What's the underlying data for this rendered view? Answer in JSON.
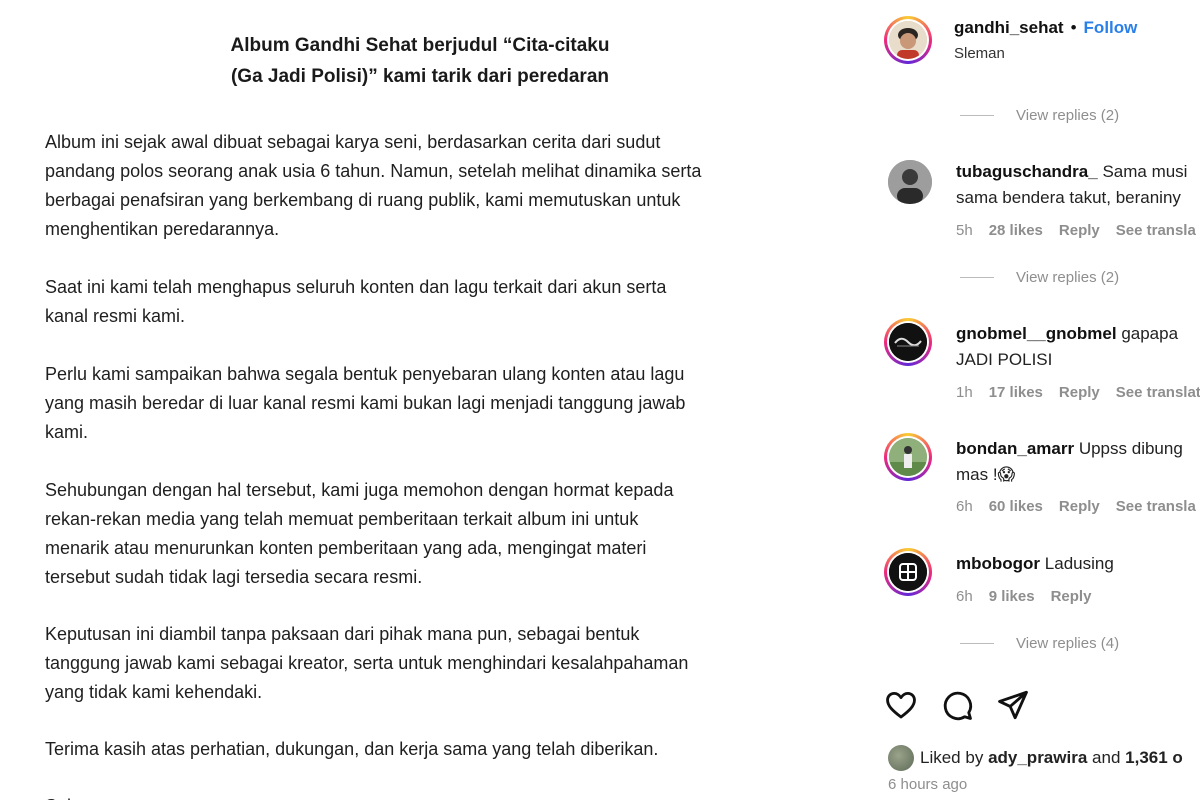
{
  "post": {
    "title_lines": [
      "Album Gandhi Sehat berjudul “Cita-citaku",
      "(Ga Jadi Polisi)” kami tarik dari peredaran"
    ],
    "paragraphs": [
      [
        "Album ini sejak awal dibuat sebagai karya seni, berdasarkan cerita dari sudut",
        "pandang polos seorang anak usia 6 tahun. Namun, setelah melihat dinamika serta",
        "berbagai penafsiran yang berkembang di ruang publik, kami memutuskan untuk",
        "menghentikan peredarannya."
      ],
      [
        "Saat ini kami telah menghapus seluruh konten dan lagu terkait dari akun serta",
        "kanal resmi kami."
      ],
      [
        "Perlu kami sampaikan bahwa segala bentuk penyebaran ulang konten atau lagu",
        "yang masih beredar di luar kanal resmi kami bukan lagi menjadi tanggung jawab",
        "kami."
      ],
      [
        "Sehubungan dengan hal tersebut, kami juga memohon dengan hormat kepada",
        "rekan-rekan media yang telah memuat pemberitaan terkait album ini untuk",
        "menarik atau menurunkan konten pemberitaan yang ada, mengingat materi",
        "tersebut sudah tidak lagi tersedia secara resmi."
      ],
      [
        "Keputusan ini diambil tanpa paksaan dari pihak mana pun, sebagai bentuk",
        "tanggung jawab kami sebagai kreator, serta untuk menghindari kesalahpahaman",
        "yang tidak kami kehendaki."
      ],
      [
        "Terima kasih atas perhatian, dukungan, dan kerja sama yang telah diberikan."
      ]
    ],
    "trailing_stub": "Sal"
  },
  "header": {
    "username": "gandhi_sehat",
    "separator": "•",
    "follow": "Follow",
    "location": "Sleman"
  },
  "comments": [
    {
      "username": "tubaguschandra_",
      "text_line1": "Sama musi",
      "text_line2": "sama bendera takut, beraniny",
      "time": "5h",
      "likes": "28 likes",
      "reply": "Reply",
      "translate": "See transla"
    },
    {
      "username": "gnobmel__gnobmel",
      "text_line1": "gapapa",
      "text_line2": "JADI POLISI",
      "time": "1h",
      "likes": "17 likes",
      "reply": "Reply",
      "translate": "See translat"
    },
    {
      "username": "bondan_amarr",
      "text_line1": "Uppss dibung",
      "text_line2": "mas !😱",
      "time": "6h",
      "likes": "60 likes",
      "reply": "Reply",
      "translate": "See transla"
    },
    {
      "username": "mbobogor",
      "text_line1": "Ladusing",
      "text_line2": "",
      "time": "6h",
      "likes": "9 likes",
      "reply": "Reply",
      "translate": ""
    }
  ],
  "view_replies": [
    "View replies (2)",
    "View replies (2)",
    "View replies (4)"
  ],
  "actions": {
    "like_icon": "heart-icon",
    "comment_icon": "comment-icon",
    "share_icon": "send-icon"
  },
  "likes_summary": {
    "prefix": "Liked by",
    "user": "ady_prawira",
    "middle": "and",
    "count": "1,361 o"
  },
  "timestamp": "6 hours ago",
  "colors": {
    "follow": "#2a7fe8",
    "meta": "#8e8e8e"
  }
}
